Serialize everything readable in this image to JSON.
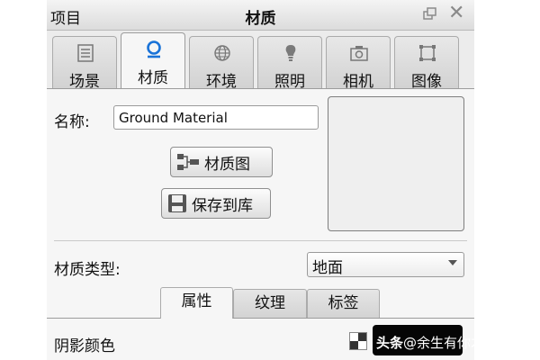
{
  "titlebar": {
    "left_label": "项目",
    "title": "材质",
    "float_icon": "restore-window-icon",
    "close_icon": "close-icon"
  },
  "tabs": [
    {
      "label": "场景",
      "icon": "list-icon",
      "active": false
    },
    {
      "label": "材质",
      "icon": "material-sphere-icon",
      "active": true
    },
    {
      "label": "环境",
      "icon": "globe-icon",
      "active": false
    },
    {
      "label": "照明",
      "icon": "lightbulb-icon",
      "active": false
    },
    {
      "label": "相机",
      "icon": "camera-icon",
      "active": false
    },
    {
      "label": "图像",
      "icon": "image-frame-icon",
      "active": false
    }
  ],
  "material": {
    "name_label": "名称:",
    "name_value": "Ground Material",
    "graph_button": "材质图",
    "save_button": "保存到库",
    "type_label": "材质类型:",
    "type_value": "地面"
  },
  "subtabs": [
    {
      "label": "属性",
      "active": true
    },
    {
      "label": "纹理",
      "active": false
    },
    {
      "label": "标签",
      "active": false
    }
  ],
  "properties": {
    "shadow_color_label": "阴影颜色",
    "shadow_color": "#050505"
  },
  "watermark": {
    "brand": "头条",
    "user": "@余生有你才安好呐"
  }
}
